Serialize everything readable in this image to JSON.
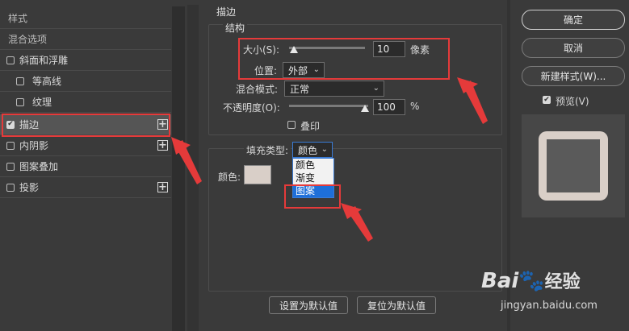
{
  "left": {
    "header": "样式",
    "blend_options": "混合选项",
    "items": [
      {
        "label": "斜面和浮雕",
        "checked": false,
        "indent": false,
        "plus": false
      },
      {
        "label": "等高线",
        "checked": false,
        "indent": true,
        "plus": false
      },
      {
        "label": "纹理",
        "checked": false,
        "indent": true,
        "plus": false
      },
      {
        "label": "描边",
        "checked": true,
        "indent": false,
        "plus": true
      },
      {
        "label": "内阴影",
        "checked": false,
        "indent": false,
        "plus": true
      },
      {
        "label": "图案叠加",
        "checked": false,
        "indent": false,
        "plus": false
      },
      {
        "label": "投影",
        "checked": false,
        "indent": false,
        "plus": true
      }
    ]
  },
  "stroke": {
    "title": "描边",
    "structure": "结构",
    "size_label": "大小(S):",
    "size_value": "10",
    "size_unit": "像素",
    "position_label": "位置:",
    "position_value": "外部",
    "blend_label": "混合模式:",
    "blend_value": "正常",
    "opacity_label": "不透明度(O):",
    "opacity_value": "100",
    "opacity_unit": "%",
    "overprint_label": "叠印",
    "fill_type_label": "填充类型:",
    "fill_type_value": "颜色",
    "fill_options": [
      "颜色",
      "渐变",
      "图案"
    ],
    "color_label": "颜色:",
    "color_swatch": "#d9cfc8",
    "set_default": "设置为默认值",
    "reset_default": "复位为默认值"
  },
  "right": {
    "ok": "确定",
    "cancel": "取消",
    "new_style": "新建样式(W)...",
    "preview_label": "预览(V)",
    "preview_checked": true
  },
  "watermark": {
    "brand": "Bai",
    "brand2": "经验",
    "url": "jingyan.baidu.com"
  }
}
